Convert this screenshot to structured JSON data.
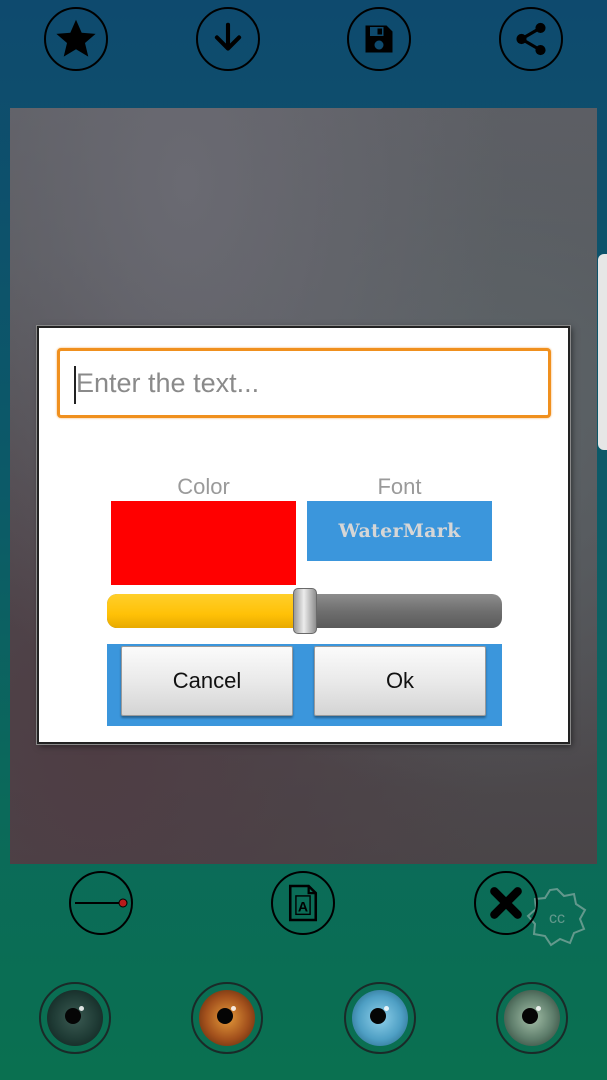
{
  "toolbar_top": {
    "icons": [
      "star-icon",
      "download-icon",
      "save-icon",
      "share-icon"
    ]
  },
  "dialog": {
    "input": {
      "placeholder": "Enter the text...",
      "value": ""
    },
    "color_label": "Color",
    "font_label": "Font",
    "font_preview": "WaterMark",
    "selected_color": "#ff0000",
    "font_swatch_color": "#3b96dc",
    "slider": {
      "value_fraction": 0.5
    },
    "cancel_label": "Cancel",
    "ok_label": "Ok"
  },
  "toolbar_bottom": {
    "icons": [
      "line-tool-icon",
      "text-file-icon",
      "close-icon"
    ]
  },
  "eye_choices": [
    {
      "name": "dark-green-eye",
      "iris_color": "#1f3b35"
    },
    {
      "name": "brown-eye",
      "iris_color": "#a2501c"
    },
    {
      "name": "blue-eye",
      "iris_color": "#4e9fc4"
    },
    {
      "name": "green-eye",
      "iris_color": "#5d7c6a"
    }
  ],
  "colors": {
    "input_border": "#f0901e",
    "slider_fill": "#ffc107",
    "button_bar": "#3b96dc"
  }
}
